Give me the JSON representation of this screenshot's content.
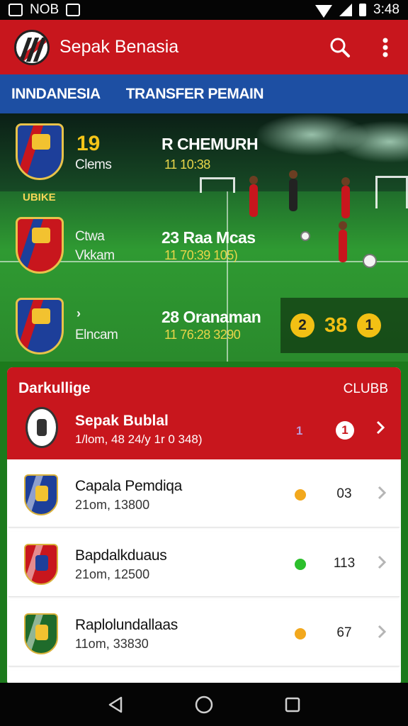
{
  "status_bar": {
    "left_text": "NOB",
    "time": "3:48"
  },
  "app_bar": {
    "title": "Sepak Benasia",
    "icons": [
      "search-icon",
      "more-vert-icon"
    ]
  },
  "tabs": [
    {
      "label": "INNDANESIA"
    },
    {
      "label": "TRANSFER PEMAIN"
    }
  ],
  "hero": {
    "badge_label": "UBIKE",
    "matches": [
      {
        "score": "19",
        "left_name": "Clems",
        "right_team": "R CHEMURH",
        "right_time": "11  10:38",
        "crest_colors": [
          "#1d3f9a",
          "#c8161d"
        ]
      },
      {
        "score": "",
        "left_name": "Ctwa\nVkkam",
        "right_team": "23  Raa Mcas",
        "right_time": "11  70:39  105)",
        "crest_colors": [
          "#c8161d",
          "#1d3f9a"
        ]
      },
      {
        "score": "",
        "left_name": "Elncam",
        "right_team": "28  Oranaman",
        "right_time": "11  76:28  3290",
        "crest_colors": [
          "#1d3f9a",
          "#c8161d"
        ]
      }
    ],
    "live": {
      "left_pill": "2",
      "score": "38",
      "right_pill": "1"
    }
  },
  "panel": {
    "title": "Darkullige",
    "link": "CLUBB",
    "featured": {
      "name": "Sepak Bublal",
      "meta": "1/lom, 48 24/y 1r 0 348)",
      "points": "1",
      "badge": "1"
    },
    "clubs": [
      {
        "name": "Capala Pemdiqa",
        "meta": "21om, 13800",
        "value": "03",
        "dot_color": "#f2a81d",
        "crest_colors": [
          "#1d3f9a",
          "#c8161d"
        ]
      },
      {
        "name": "Bapdalkduaus",
        "meta": "21om, 12500",
        "value": "113",
        "dot_color": "#2cbf2c",
        "crest_colors": [
          "#c8161d",
          "#1d3f9a"
        ]
      },
      {
        "name": "Raplolundallaas",
        "meta": "11om, 33830",
        "value": "67",
        "dot_color": "#f2a81d",
        "crest_colors": [
          "#1f6b2b",
          "#111111"
        ]
      }
    ]
  },
  "nav": {
    "icons": [
      "back-icon",
      "home-icon",
      "recents-icon"
    ]
  }
}
